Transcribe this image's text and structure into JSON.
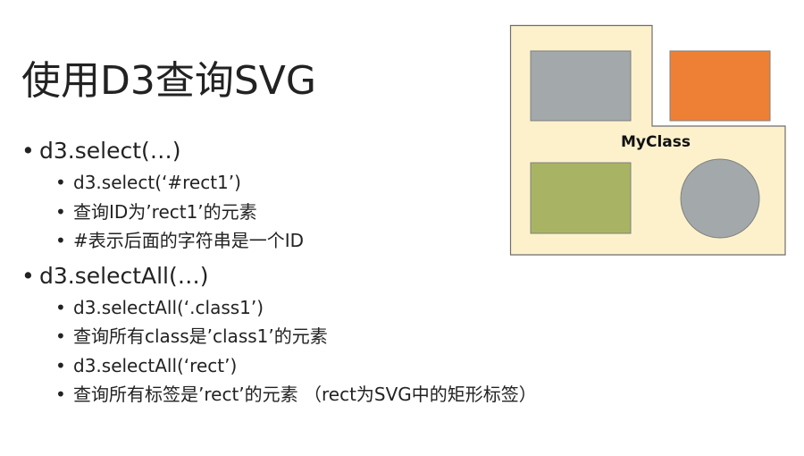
{
  "title": "使用D3查询SVG",
  "bullets": [
    {
      "text": "d3.select(…)",
      "children": [
        "d3.select(‘#rect1’)",
        "查询ID为’rect1’的元素",
        "#表示后面的字符串是一个ID"
      ]
    },
    {
      "text": "d3.selectAll(…)",
      "children": [
        "d3.selectAll(‘.class1’)",
        "查询所有class是’class1’的元素",
        "d3.selectAll(‘rect’)",
        "查询所有标签是’rect’的元素 （rect为SVG中的矩形标签）"
      ]
    }
  ],
  "diagram": {
    "group_label": "MyClass",
    "colors": {
      "panel": "#fdf1cc",
      "panel_border": "#6e6e6e",
      "gray": "#a3a9ab",
      "orange": "#ee8035",
      "green": "#a8b464"
    }
  }
}
